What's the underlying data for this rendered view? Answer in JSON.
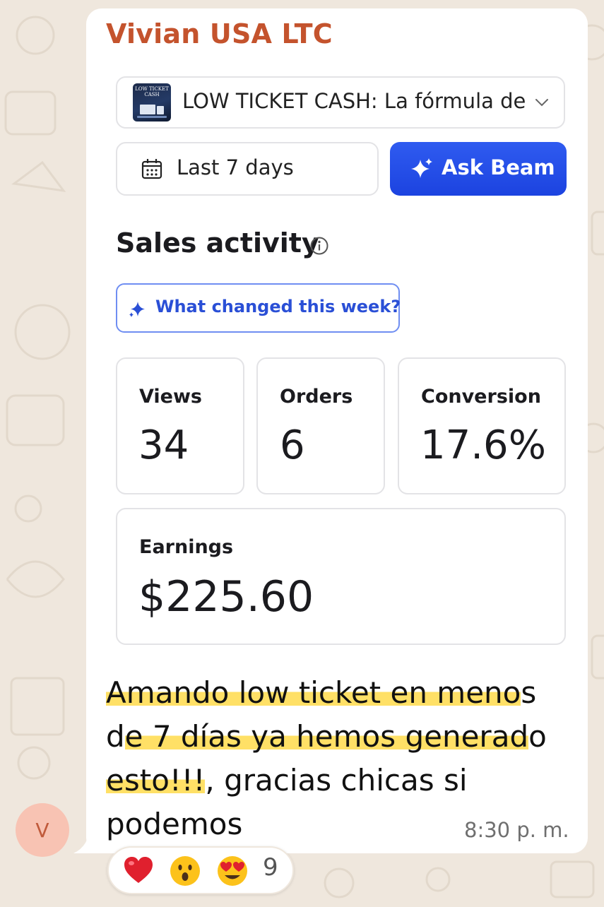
{
  "chat": {
    "sender": "Vivian USA LTC",
    "avatar_initial": "V",
    "time": "8:30 p. m.",
    "message": {
      "highlight_1": "Amando low ticket en meno",
      "plain_1": "s",
      "plain_2": "d",
      "highlight_2": "e 7 días ya hemos generad",
      "plain_3": "o",
      "highlight_3": "esto!!!",
      "plain_4": ", gracias chicas si podemos"
    },
    "reactions": {
      "icons": [
        "red-heart-icon",
        "astonished-face-icon",
        "heart-eyes-face-icon"
      ],
      "count": "9"
    }
  },
  "screenshot": {
    "product": {
      "label": "LOW TICKET CASH: La fórmula de",
      "thumb_text": "LOW TICKET CASH"
    },
    "date_range": "Last 7 days",
    "ask_button": "Ask Beam",
    "section_title": "Sales activity",
    "changed_button": "What changed this week?",
    "stats": {
      "views": {
        "label": "Views",
        "value": "34"
      },
      "orders": {
        "label": "Orders",
        "value": "6"
      },
      "conversion": {
        "label": "Conversion",
        "value": "17.6%"
      },
      "earnings": {
        "label": "Earnings",
        "value": "$225.60"
      }
    }
  },
  "colors": {
    "sender": "#c4532d",
    "accent_blue": "#1c43e0",
    "highlight": "#ffe066",
    "wallpaper": "#efe7dd"
  }
}
